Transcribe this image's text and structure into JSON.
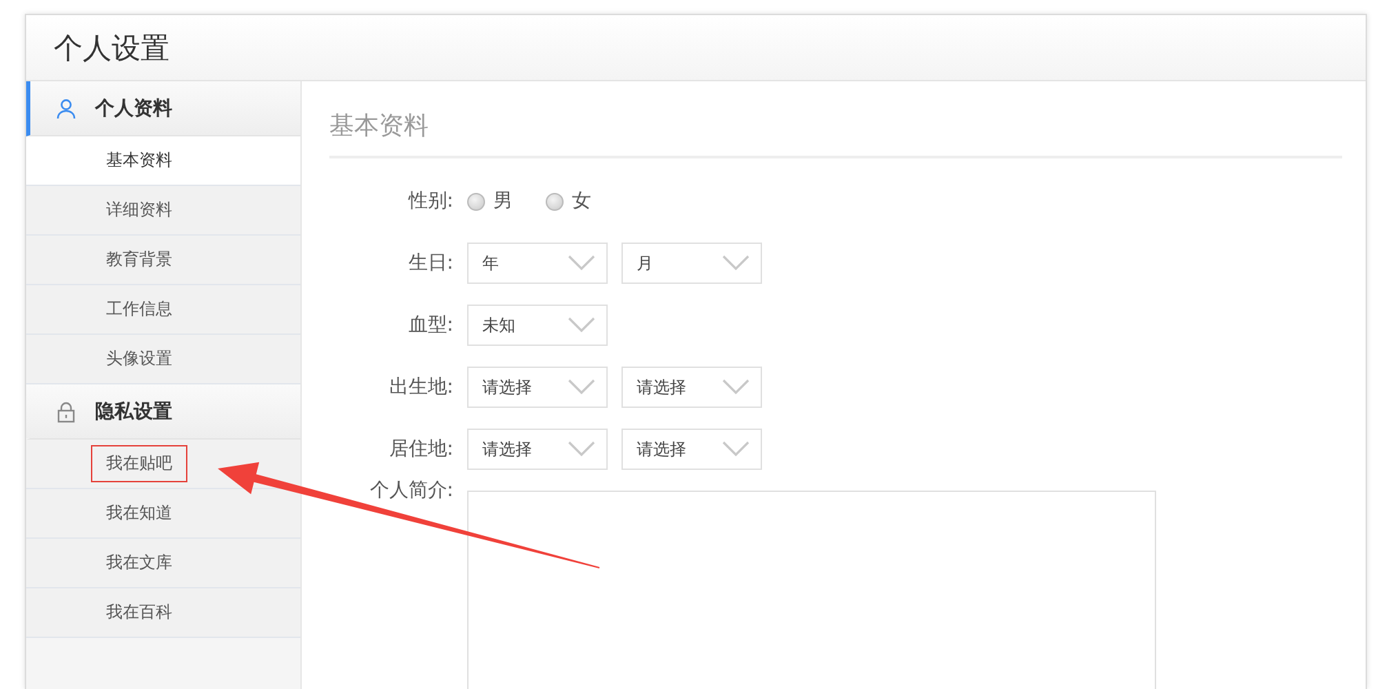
{
  "page_title": "个人设置",
  "sidebar": {
    "groups": [
      {
        "title": "个人资料",
        "selected": true,
        "items": [
          {
            "label": "基本资料",
            "selected": true,
            "marked": false
          },
          {
            "label": "详细资料",
            "selected": false,
            "marked": false
          },
          {
            "label": "教育背景",
            "selected": false,
            "marked": false
          },
          {
            "label": "工作信息",
            "selected": false,
            "marked": false
          },
          {
            "label": "头像设置",
            "selected": false,
            "marked": false
          }
        ]
      },
      {
        "title": "隐私设置",
        "selected": false,
        "items": [
          {
            "label": "我在贴吧",
            "selected": false,
            "marked": true
          },
          {
            "label": "我在知道",
            "selected": false,
            "marked": false
          },
          {
            "label": "我在文库",
            "selected": false,
            "marked": false
          },
          {
            "label": "我在百科",
            "selected": false,
            "marked": false
          }
        ]
      }
    ]
  },
  "content": {
    "heading": "基本资料",
    "fields": [
      {
        "kind": "radio",
        "label": "性别:",
        "options": [
          {
            "label": "男",
            "selected": false
          },
          {
            "label": "女",
            "selected": false
          }
        ]
      },
      {
        "kind": "select",
        "label": "生日:",
        "selects": [
          {
            "value": "年"
          },
          {
            "value": "月"
          }
        ]
      },
      {
        "kind": "select",
        "label": "血型:",
        "selects": [
          {
            "value": "未知"
          }
        ]
      },
      {
        "kind": "select",
        "label": "出生地:",
        "selects": [
          {
            "value": "请选择"
          },
          {
            "value": "请选择"
          }
        ]
      },
      {
        "kind": "select",
        "label": "居住地:",
        "selects": [
          {
            "value": "请选择"
          },
          {
            "value": "请选择"
          }
        ]
      },
      {
        "kind": "textarea",
        "label": "个人简介:"
      }
    ]
  },
  "arrow": true
}
